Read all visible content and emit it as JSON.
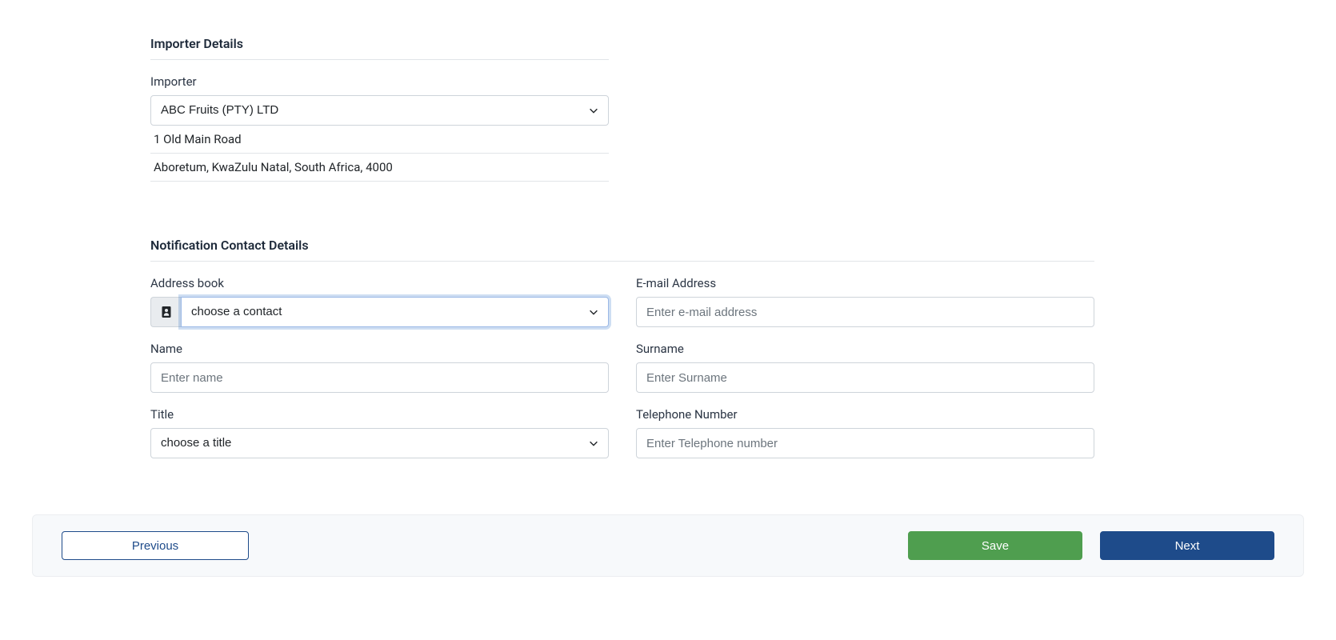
{
  "importer": {
    "heading": "Importer Details",
    "label": "Importer",
    "selected": "ABC Fruits (PTY) LTD",
    "address_line1": "1 Old Main Road",
    "address_line2": "Aboretum, KwaZulu Natal, South Africa, 4000"
  },
  "notification": {
    "heading": "Notification Contact Details",
    "address_book_label": "Address book",
    "address_book_placeholder": "choose a contact",
    "email_label": "E-mail Address",
    "email_placeholder": "Enter e-mail address",
    "name_label": "Name",
    "name_placeholder": "Enter name",
    "surname_label": "Surname",
    "surname_placeholder": "Enter Surname",
    "title_label": "Title",
    "title_placeholder": "choose a title",
    "telephone_label": "Telephone Number",
    "telephone_placeholder": "Enter Telephone number"
  },
  "footer": {
    "previous": "Previous",
    "save": "Save",
    "next": "Next"
  }
}
